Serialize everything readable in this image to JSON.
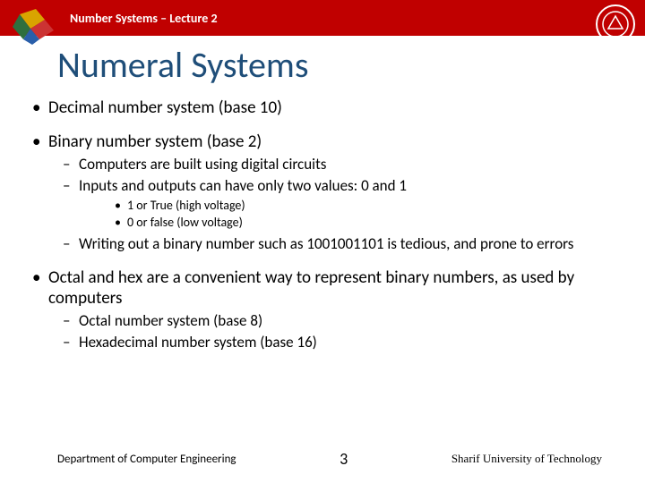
{
  "header": {
    "lecture_label": "Number Systems – Lecture 2"
  },
  "title": "Numeral Systems",
  "bullets": {
    "b1": "Decimal number system (base 10)",
    "b2": "Binary number system (base 2)",
    "b2_s1": "Computers are built using digital circuits",
    "b2_s2": "Inputs and outputs can have only two values: 0 and 1",
    "b2_s2_a": "1  or  True  (high voltage)",
    "b2_s2_b": "0  or  false  (low voltage)",
    "b2_s3": "Writing out a binary number such as  1001001101 is tedious, and prone to errors",
    "b3": "Octal and hex are a convenient way to represent binary numbers, as used by computers",
    "b3_s1": "Octal number system (base 8)",
    "b3_s2": "Hexadecimal number system (base 16)"
  },
  "footer": {
    "department": "Department of Computer Engineering",
    "page": "3",
    "university": "Sharif University of Technology"
  }
}
